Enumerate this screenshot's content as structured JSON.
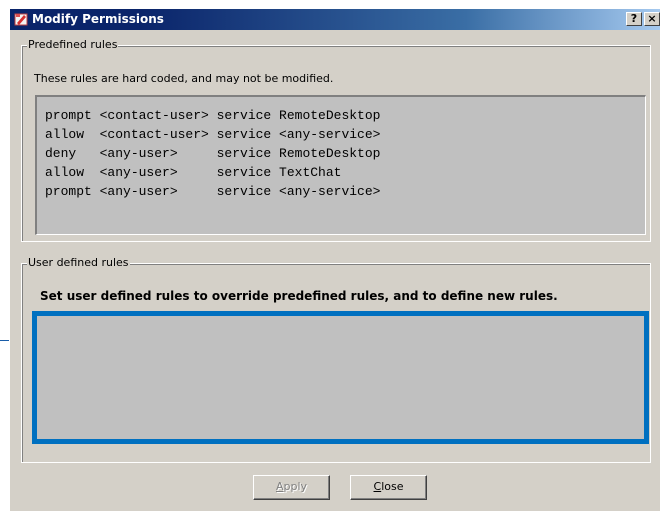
{
  "window": {
    "title": "Modify Permissions",
    "help_label": "?",
    "close_label": "×"
  },
  "predefined": {
    "legend": "Predefined rules",
    "note": "These rules are hard coded, and may not be modified.",
    "rules": [
      "prompt <contact-user> service RemoteDesktop",
      "allow  <contact-user> service <any-service>",
      "deny   <any-user>     service RemoteDesktop",
      "allow  <any-user>     service TextChat",
      "prompt <any-user>     service <any-service>"
    ]
  },
  "user_defined": {
    "legend": "User defined rules",
    "note": "Set user defined rules to override predefined rules, and to define new rules.",
    "highlight_color": "#0070c0"
  },
  "buttons": {
    "apply": {
      "first": "A",
      "rest": "pply",
      "enabled": false
    },
    "close": {
      "first": "C",
      "rest": "lose",
      "enabled": true
    }
  }
}
